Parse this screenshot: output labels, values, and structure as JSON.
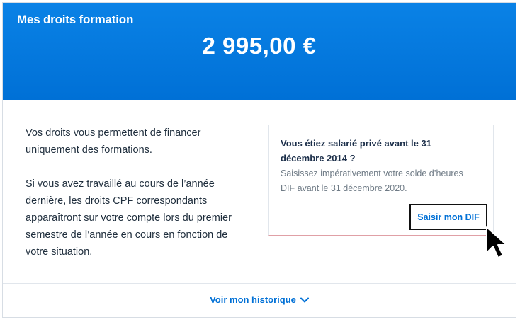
{
  "header": {
    "title": "Mes droits formation",
    "amount": "2 995,00 €",
    "background_color": "#0a7de4"
  },
  "info": {
    "paragraph1": "Vos droits vous permettent de financer uniquement des formations.",
    "paragraph2": "Si vous avez travaillé au cours de l’année dernière, les droits CPF correspondants apparaîtront sur votre compte lors du premier semestre de l’année en cours en fonction de votre situation."
  },
  "dif_card": {
    "title": "Vous étiez salarié privé avant le 31 décembre 2014 ?",
    "description": "Saisissez impérativement votre solde d’heures DIF avant le 31 décembre 2020.",
    "button_label": "Saisir mon DIF",
    "icon": "cursor-arrow-icon"
  },
  "footer": {
    "history_label": "Voir mon historique",
    "icon": "chevron-down-icon",
    "link_color": "#0070d6"
  }
}
